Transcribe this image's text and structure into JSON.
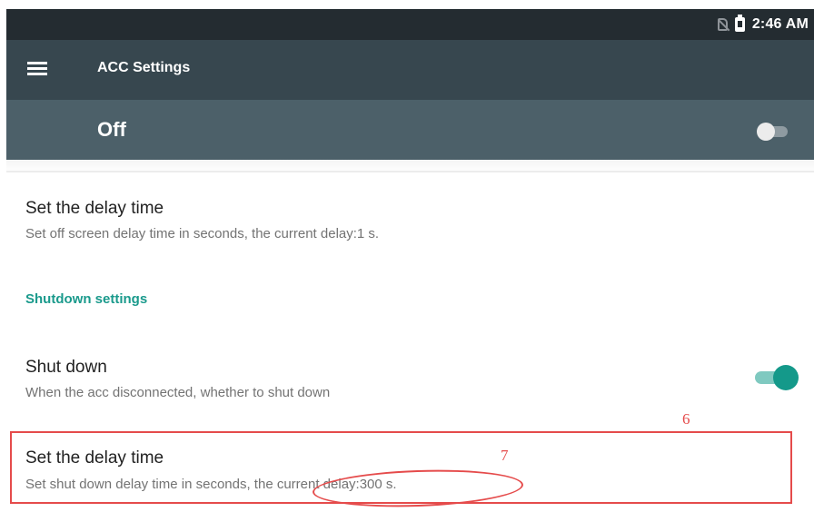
{
  "status_bar": {
    "time": "2:46 AM",
    "icons": [
      "no-sim-icon",
      "battery-icon"
    ]
  },
  "toolbar": {
    "title": "ACC Settings",
    "menu_icon": "menu-icon"
  },
  "master_switch": {
    "label": "Off",
    "state": "off"
  },
  "preferences": {
    "screen_delay": {
      "title": "Set the delay time",
      "summary": "Set off screen delay time in seconds, the current delay:1 s."
    },
    "category": {
      "title": "Shutdown settings"
    },
    "shut_down": {
      "title": "Shut down",
      "summary": "When the acc disconnected, whether to shut down",
      "state": "on"
    },
    "shutdown_delay": {
      "title": "Set the delay time",
      "summary": "Set shut down delay time in seconds, the current delay:300 s."
    }
  },
  "annotations": {
    "box_label": "6",
    "ellipse_label": "7"
  },
  "colors": {
    "status_bar": "#242c31",
    "toolbar": "#37474f",
    "master_bar": "#4c6069",
    "accent": "#1a9a8c",
    "annotation": "#e54b4b"
  }
}
